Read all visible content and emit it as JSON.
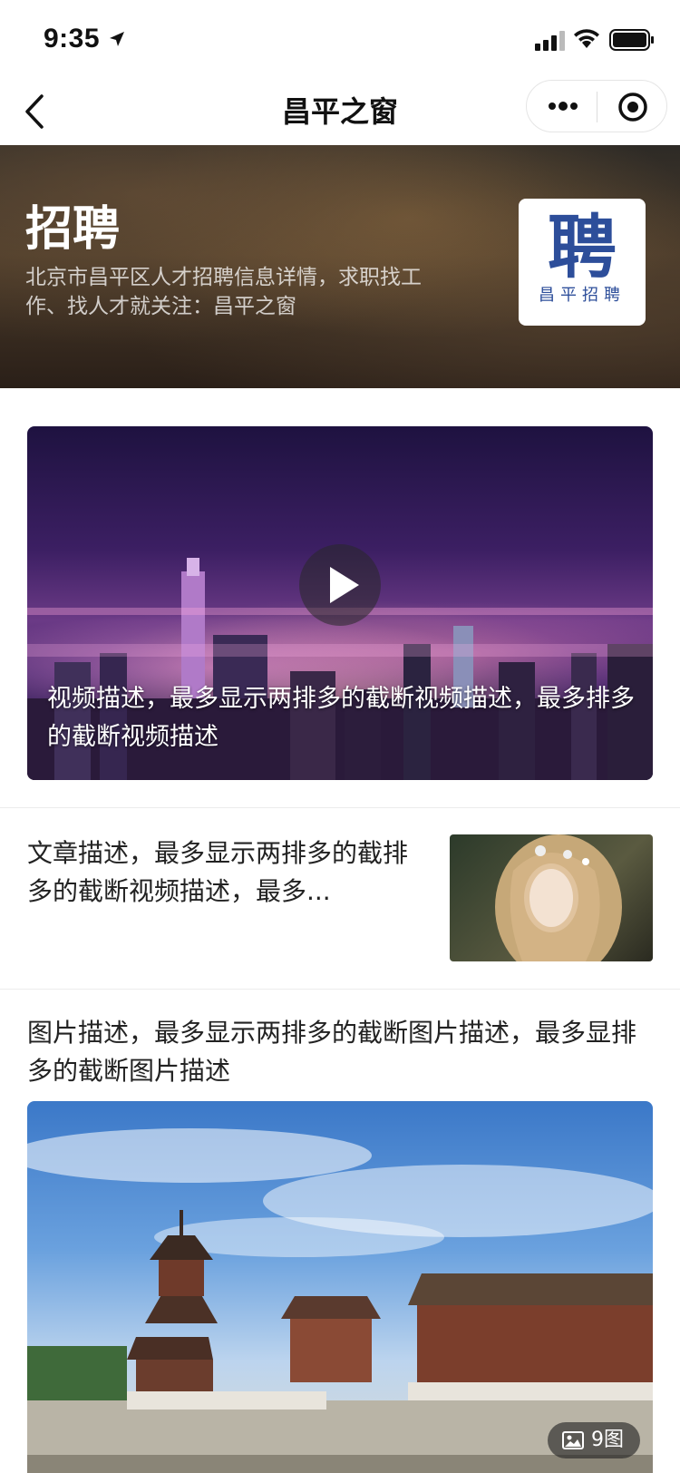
{
  "status_bar": {
    "time": "9:35"
  },
  "navbar": {
    "title": "昌平之窗"
  },
  "banner": {
    "heading": "招聘",
    "description": "北京市昌平区人才招聘信息详情，求职找工作、找人才就关注：昌平之窗",
    "logo_char": "聘",
    "logo_caption": "昌平招聘"
  },
  "video_card": {
    "caption": "视频描述，最多显示两排多的截断视频描述，最多排多的截断视频描述"
  },
  "article_card": {
    "text": "文章描述，最多显示两排多的截排多的截断视频描述，最多..."
  },
  "picture_card": {
    "text": "图片描述，最多显示两排多的截断图片描述，最多显排多的截断图片描述",
    "count_label": "9图"
  }
}
